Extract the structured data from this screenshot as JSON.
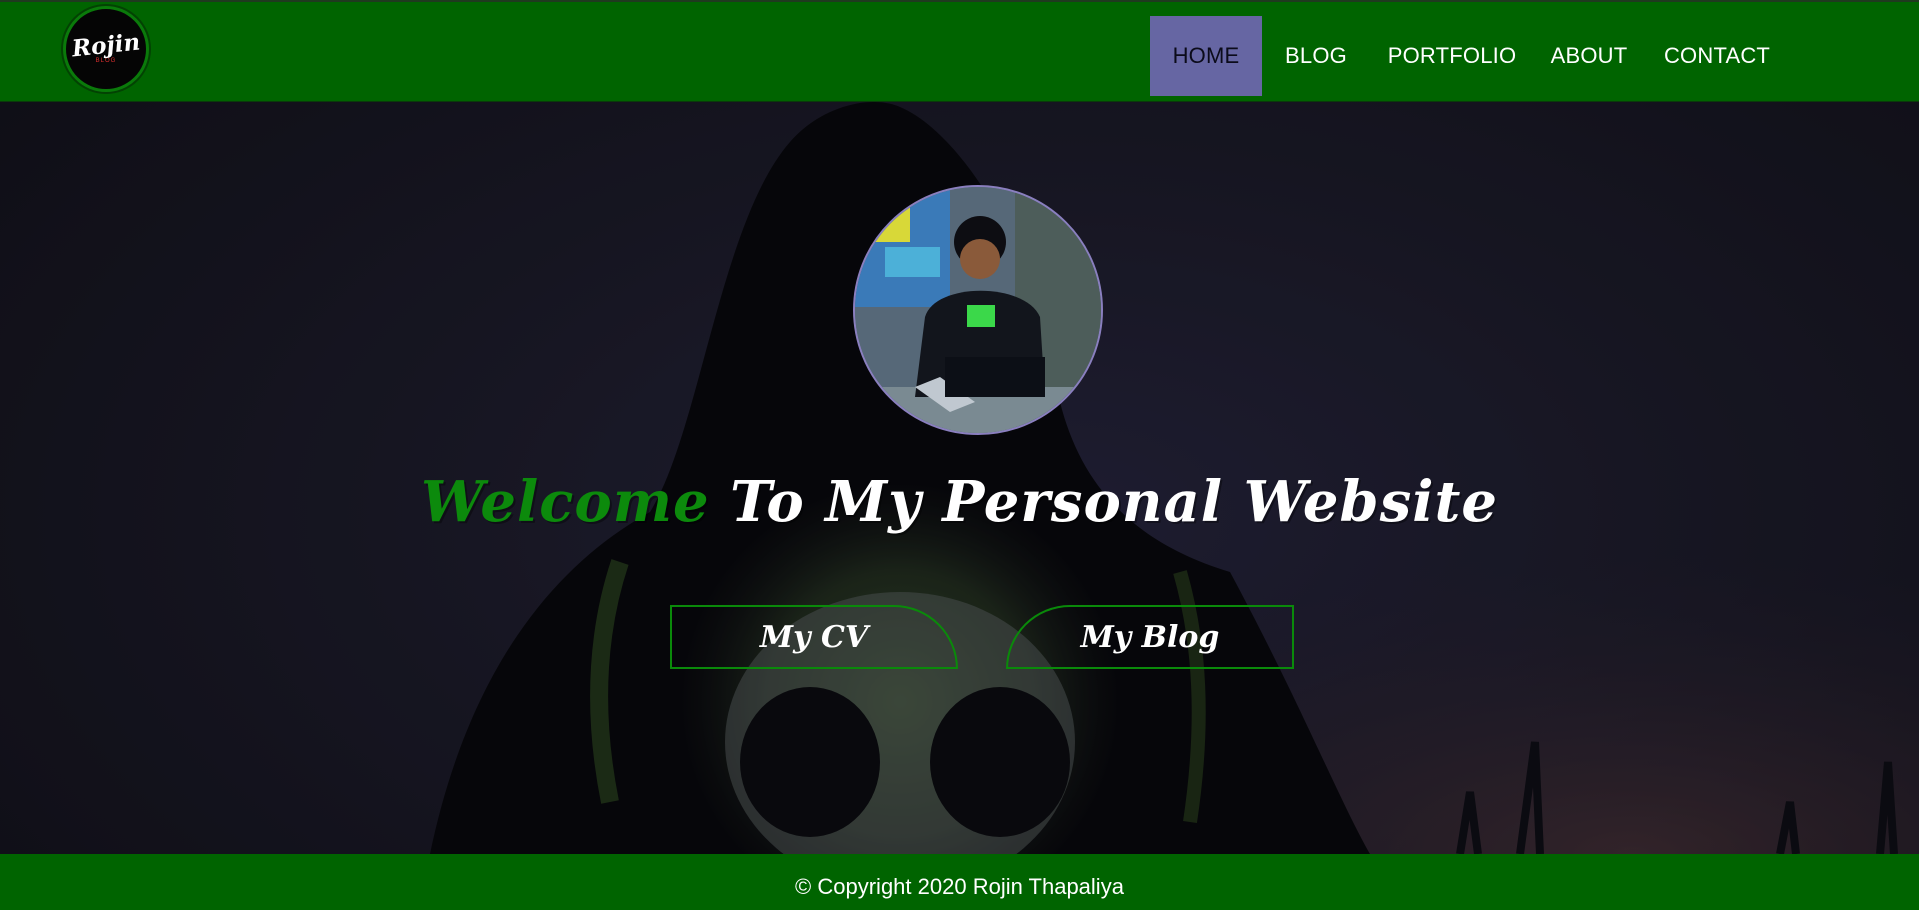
{
  "brand": {
    "logo_text": "Rojin",
    "logo_subtext": "BLOG"
  },
  "nav": {
    "items": [
      {
        "label": "HOME",
        "active": true
      },
      {
        "label": "BLOG",
        "active": false
      },
      {
        "label": "PORTFOLIO",
        "active": false
      },
      {
        "label": "ABOUT",
        "active": false
      },
      {
        "label": "CONTACT",
        "active": false
      }
    ]
  },
  "hero": {
    "title_accent": "Welcome",
    "title_rest": " To My Personal Website",
    "buttons": {
      "cv": "My CV",
      "blog": "My Blog"
    }
  },
  "footer": {
    "copyright": "© Copyright 2020 Rojin Thapaliya"
  },
  "colors": {
    "nav_bg": "#006400",
    "nav_active_bg": "#6666a3",
    "accent_green": "#0c8a0c",
    "footer_bg": "#006400"
  }
}
